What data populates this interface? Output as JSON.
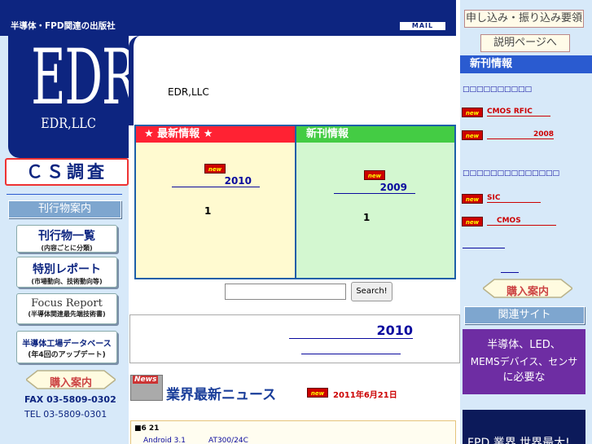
{
  "header": {
    "tagline": "半導体・FPD関連の出版社",
    "mail": "MAIL"
  },
  "logo": {
    "mark": "EDR",
    "name": "EDR,LLC"
  },
  "left_nav": {
    "cs": "ＣＳ調査",
    "guide": "刊行物案内",
    "items": [
      {
        "title": "刊行物一覧",
        "sub": "(内容ごとに分類)"
      },
      {
        "title": "特別レポート",
        "sub": "(市場動向、技術動向等)"
      },
      {
        "title": "Focus Report",
        "sub": "(半導体関連最先端技術書)"
      },
      {
        "title": "半導体工場データベース",
        "sub": "(年4回のアップデート)"
      }
    ],
    "buy": "購入案内",
    "fax": "FAX 03-5809-0302",
    "tel": "TEL 03-5809-0301"
  },
  "main": {
    "company": "EDR,LLC",
    "latest": {
      "title": "★ 最新情報 ★",
      "badge": "new",
      "year": "2010",
      "num": "1"
    },
    "new_pub": {
      "title": "新刊情報",
      "badge": "new",
      "year": "2009",
      "num": "1"
    },
    "search_button": "Search!",
    "search_placeholder": "",
    "feature_year": "2010",
    "news": {
      "banner_tag": "News",
      "banner": "業界最新ニュース",
      "badge": "new",
      "date": "2011年6月21日",
      "item_date": "■6 21",
      "item_text1": "Android 3.1",
      "item_text2": "AT300/24C"
    }
  },
  "right": {
    "apply": "申し込み・振り込み要領",
    "explain": "説明ページへ",
    "new_info": "新刊情報",
    "link1": "□□□□□□□□□□",
    "cmos_rfic": "CMOS RFIC",
    "y2008": "2008",
    "link2": "□□□□□□□□□□□□□□",
    "sic": "SIC",
    "cmos": "CMOS",
    "buy": "購入案内",
    "related": "関連サイト",
    "promo": [
      "半導体、LED、",
      "MEMSデバイス、センサ",
      "に必要な"
    ],
    "bottom": "FPD 業界 世界最大!"
  },
  "colors": {
    "navy": "#0d2580",
    "panel": "#d7e9f9",
    "red": "#f23",
    "green": "#4c4"
  }
}
